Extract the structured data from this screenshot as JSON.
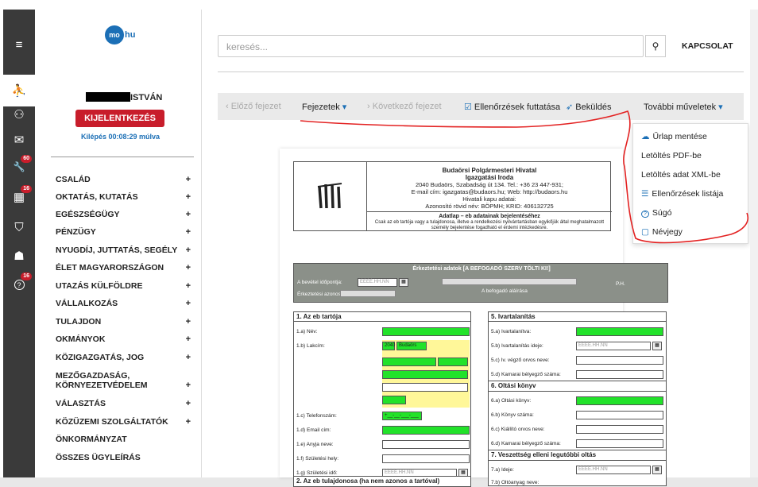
{
  "sidebar_icons": [
    {
      "name": "menu-icon",
      "glyph": "≡",
      "badge": ""
    },
    {
      "name": "accessibility-icon",
      "glyph": "⛹",
      "badge": ""
    },
    {
      "name": "user-icon",
      "glyph": "⚇",
      "badge": ""
    },
    {
      "name": "mail-icon",
      "glyph": "✉",
      "badge": ""
    },
    {
      "name": "wrench-icon",
      "glyph": "🔧",
      "badge": "60"
    },
    {
      "name": "building-icon",
      "glyph": "▦",
      "badge": "16"
    },
    {
      "name": "shield-icon",
      "glyph": "⛉",
      "badge": ""
    },
    {
      "name": "add-user-icon",
      "glyph": "☗",
      "badge": ""
    },
    {
      "name": "help-icon",
      "glyph": "?",
      "badge": "16"
    }
  ],
  "logo": {
    "mark": "mo",
    "text": "hu"
  },
  "user": {
    "name": "ISTVÁN",
    "logout_label": "KIJELENTKEZÉS",
    "timer": "Kilépés 00:08:29 múlva"
  },
  "menu": [
    {
      "label": "CSALÁD",
      "plus": "+"
    },
    {
      "label": "OKTATÁS, KUTATÁS",
      "plus": "+"
    },
    {
      "label": "EGÉSZSÉGÜGY",
      "plus": "+"
    },
    {
      "label": "PÉNZÜGY",
      "plus": "+"
    },
    {
      "label": "NYUGDÍJ, JUTTATÁS, SEGÉLY",
      "plus": "+"
    },
    {
      "label": "ÉLET MAGYARORSZÁGON",
      "plus": "+"
    },
    {
      "label": "UTAZÁS KÜLFÖLDRE",
      "plus": "+"
    },
    {
      "label": "VÁLLALKOZÁS",
      "plus": "+"
    },
    {
      "label": "TULAJDON",
      "plus": "+"
    },
    {
      "label": "OKMÁNYOK",
      "plus": "+"
    },
    {
      "label": "KÖZIGAZGATÁS, JOG",
      "plus": "+"
    },
    {
      "label": "MEZŐGAZDASÁG, KÖRNYEZETVÉDELEM",
      "plus": "+"
    },
    {
      "label": "VÁLASZTÁS",
      "plus": "+"
    },
    {
      "label": "KÖZÜZEMI SZOLGÁLTATÓK",
      "plus": "+"
    },
    {
      "label": "ÖNKORMÁNYZAT",
      "plus": ""
    },
    {
      "label": "ÖSSZES ÜGYLEÍRÁS",
      "plus": ""
    }
  ],
  "search": {
    "placeholder": "keresés...",
    "contact": "KAPCSOLAT"
  },
  "toolbar": {
    "prev": "Előző fejezet",
    "chapters": "Fejezetek",
    "next": "Következő fejezet",
    "checks": "Ellenőrzések futtatása",
    "send": "Beküldés",
    "more": "További műveletek"
  },
  "dropdown": [
    {
      "label": "Űrlap mentése",
      "icon": "cloud-upload-icon",
      "glyph": "☁"
    },
    {
      "label": "Letöltés PDF-be",
      "icon": "",
      "glyph": ""
    },
    {
      "label": "Letöltés adat XML-be",
      "icon": "",
      "glyph": ""
    },
    {
      "label": "Ellenőrzések listája",
      "icon": "list-icon",
      "glyph": "☰"
    },
    {
      "label": "Súgó",
      "icon": "help-icon",
      "glyph": "?"
    },
    {
      "label": "Névjegy",
      "icon": "info-card-icon",
      "glyph": "▢"
    }
  ],
  "form": {
    "office_name": "Budaörsi Polgármesteri Hivatal",
    "office_unit": "Igazgatási Iroda",
    "office_address": "2040 Budaörs, Szabadság út 134. Tel.: +36 23 447-931;",
    "office_contact": "E-mail cím: igazgatas@budaors.hu; Web: http://budaors.hu",
    "office_gateway": "Hivatali kapu adatai:",
    "office_ids": "Azonosító rövid név: BÖPMH; KRID: 406132725",
    "form_title": "Adatlap – eb adatainak bejelentéséhez",
    "form_desc": "Csak az eb tartója vagy a tulajdonosa, illetve a rendelkezési nyilvántartásban egyikőjük által meghatalmazott személy bejelentése fogadható el érdemi intézkedésre.",
    "receipt_title": "Érkeztetési adatok [A BEFOGADÓ SZERV TÖLTI KI!]",
    "receipt_date_label": "A bevétel időpontja:",
    "receipt_date_placeholder": "ÉÉÉÉ.HH.NN",
    "receipt_id_label": "Érkeztetési azonosító:",
    "receipt_sign": "A befogadó aláírása",
    "receipt_ph": "P.H.",
    "s1_title": "1. Az eb tartója",
    "s1_fields": [
      "1.a) Név:",
      "1.b) Lakcím:",
      "1.c) Telefonszám:",
      "1.d) Email cím:",
      "1.e) Anyja neve:",
      "1.f) Születési hely:",
      "1.g) Születési idő:"
    ],
    "zip": "2040",
    "city": "Budaörs",
    "phone_mask": "+__-__-___-___",
    "date_placeholder": "ÉÉÉÉ.HH.NN",
    "s2_title": "2. Az eb tulajdonosa (ha nem azonos a tartóval)",
    "s5_title": "5. Ivartalanítás",
    "s5_fields": [
      "5.a) Ivartalanítva:",
      "5.b) Ivartalanítás ideje:",
      "5.c) Iv. végző orvos neve:",
      "5.d) Kamarai bélyegző száma:"
    ],
    "s6_title": "6. Oltási könyv",
    "s6_fields": [
      "6.a) Oltási könyv:",
      "6.b) Könyv száma:",
      "6.c) Kiállító orvos neve:",
      "6.d) Kamarai bélyegző száma:"
    ],
    "s7_title": "7. Veszettség elleni legutóbbi oltás",
    "s7_fields": [
      "7.a) Ideje:",
      "7.b) Oltóanyag neve:"
    ]
  }
}
